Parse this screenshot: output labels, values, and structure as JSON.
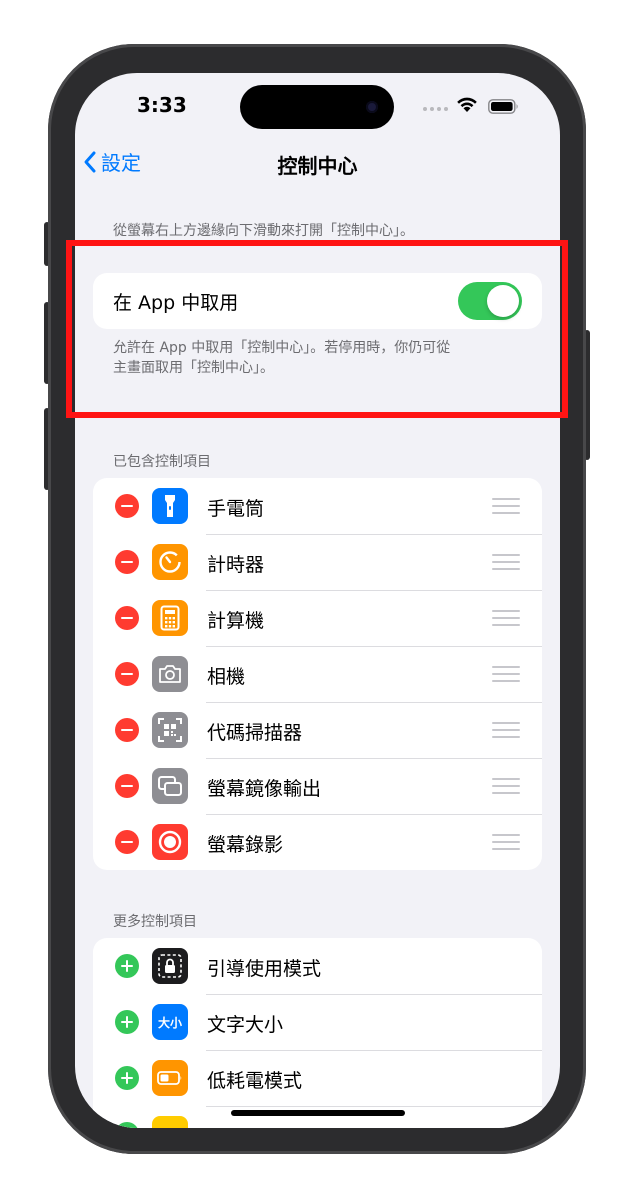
{
  "status_bar": {
    "time": "3:33"
  },
  "nav": {
    "back_label": "設定",
    "title": "控制中心"
  },
  "intro": "從螢幕右上方邊緣向下滑動來打開「控制中心」。",
  "access_in_apps": {
    "label": "在 App 中取用",
    "enabled": true,
    "footnote_line1": "允許在 App 中取用「控制中心」。若停用時，你仍可從",
    "footnote_line2": "主畫面取用「控制中心」。"
  },
  "included_controls": {
    "header": "已包含控制項目",
    "items": [
      {
        "label": "手電筒",
        "icon": "flashlight-icon",
        "color": "#007aff"
      },
      {
        "label": "計時器",
        "icon": "timer-icon",
        "color": "#ff9500"
      },
      {
        "label": "計算機",
        "icon": "calculator-icon",
        "color": "#ff9500"
      },
      {
        "label": "相機",
        "icon": "camera-icon",
        "color": "#8e8e93"
      },
      {
        "label": "代碼掃描器",
        "icon": "qr-scanner-icon",
        "color": "#8e8e93"
      },
      {
        "label": "螢幕鏡像輸出",
        "icon": "screen-mirroring-icon",
        "color": "#8e8e93"
      },
      {
        "label": "螢幕錄影",
        "icon": "screen-recording-icon",
        "color": "#ff3b30"
      }
    ]
  },
  "more_controls": {
    "header": "更多控制項目",
    "items": [
      {
        "label": "引導使用模式",
        "icon": "guided-access-icon",
        "color": "#1c1c1e"
      },
      {
        "label": "文字大小",
        "icon": "text-size-icon",
        "color": "#007aff",
        "icon_text": "大小"
      },
      {
        "label": "低耗電模式",
        "icon": "low-power-mode-icon",
        "color": "#ff9500"
      }
    ]
  },
  "colors": {
    "accent": "#007aff",
    "toggle_on": "#34c759",
    "remove": "#ff3b30",
    "add": "#34c759",
    "highlight": "#ff1414"
  }
}
